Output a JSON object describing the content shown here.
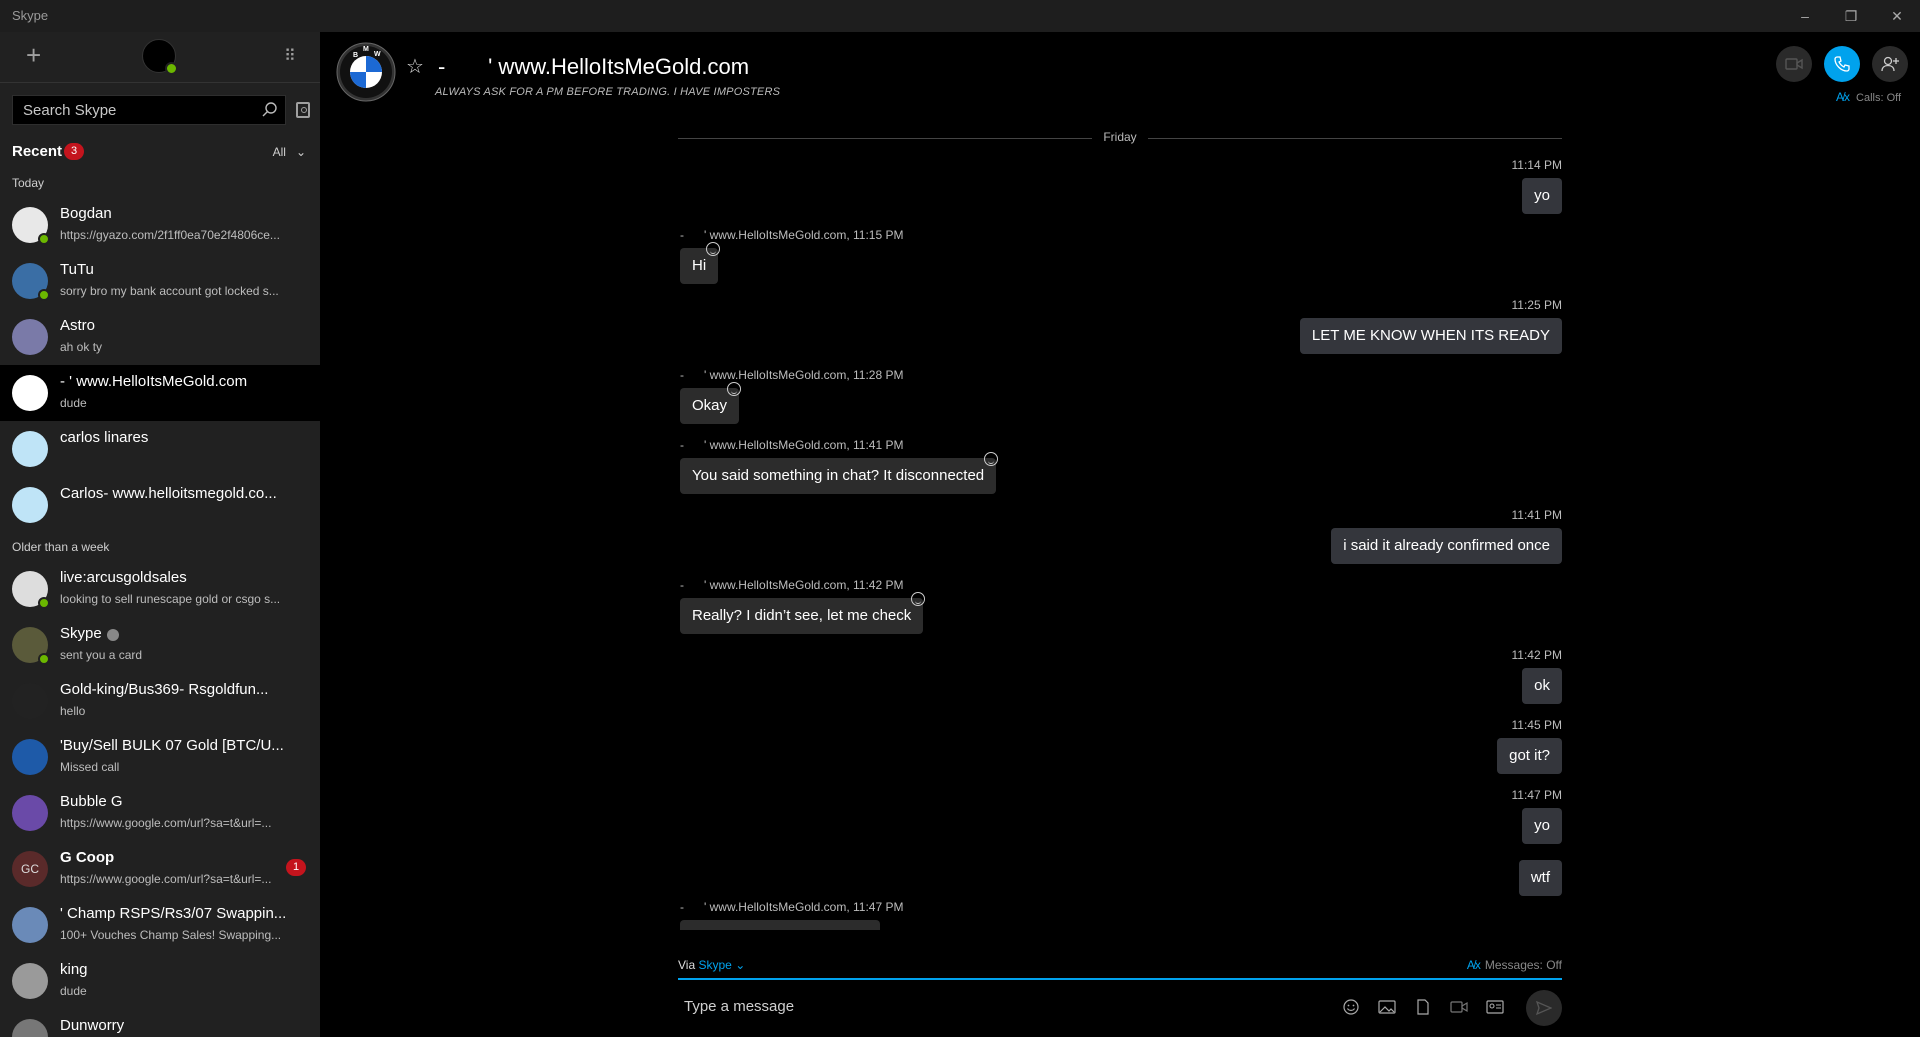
{
  "window": {
    "app_title": "Skype",
    "minimize": "–",
    "maximize": "❐",
    "close": "✕"
  },
  "sidebar": {
    "search_placeholder": "Search Skype",
    "recent_label": "Recent",
    "recent_badge": "3",
    "filter_label": "All",
    "sections": {
      "today": "Today",
      "older": "Older than a week"
    },
    "contacts": [
      {
        "name": "Bogdan",
        "preview": "https://gyazo.com/2f1ff0ea70e2f4806ce...",
        "online": true,
        "avatar_color": "#e8e8e8"
      },
      {
        "name": "TuTu",
        "preview": "sorry bro my bank account got locked s...",
        "online": true,
        "avatar_color": "#3a6ea5"
      },
      {
        "name": "Astro",
        "preview": "ah ok ty",
        "online": false,
        "avatar_color": "#7a7aa8"
      },
      {
        "name": "-       ' www.HelloItsMeGold.com",
        "preview": "dude",
        "online": false,
        "avatar_color": "#ffffff"
      },
      {
        "name": "carlos linares",
        "preview": "",
        "online": false,
        "avatar_color": "#bfe4f7"
      },
      {
        "name": "Carlos- www.helloitsmegold.co...",
        "preview": "",
        "online": false,
        "avatar_color": "#bfe4f7"
      },
      {
        "name": "live:arcusgoldsales",
        "preview": "looking to sell runescape gold or csgo s...",
        "online": true,
        "avatar_color": "#dddddd"
      },
      {
        "name": "Skype",
        "preview": "sent you a card",
        "online": true,
        "avatar_color": "#5a5a3a"
      },
      {
        "name": "Gold-king/Bus369- Rsgoldfun...",
        "preview": "hello",
        "online": false,
        "avatar_color": "#222222"
      },
      {
        "name": "'Buy/Sell BULK 07 Gold [BTC/U...",
        "preview": "Missed call",
        "online": false,
        "avatar_color": "#1e5aa8"
      },
      {
        "name": "Bubble G",
        "preview": "https://www.google.com/url?sa=t&url=...",
        "online": false,
        "avatar_color": "#6a4aa8"
      },
      {
        "name": "G Coop",
        "preview": "https://www.google.com/url?sa=t&url=...",
        "online": false,
        "avatar_color": "#5a2a2a",
        "initials": "GC",
        "unread": "1"
      },
      {
        "name": "' Champ RSPS/Rs3/07 Swappin...",
        "preview": "100+ Vouches Champ Sales! Swapping...",
        "online": false,
        "avatar_color": "#6a8ab8"
      },
      {
        "name": "king",
        "preview": "dude",
        "online": false,
        "avatar_color": "#9a9a9a"
      },
      {
        "name": "Dunworry",
        "preview": "",
        "online": false,
        "avatar_color": "#777777"
      }
    ]
  },
  "conversation": {
    "title": "-       ' www.HelloItsMeGold.com",
    "subtitle": "ALWAYS ASK FOR A PM BEFORE TRADING. I HAVE IMPOSTERS",
    "logo_letters": [
      "B",
      "M",
      "W"
    ],
    "calls_status": "Calls: Off",
    "translate_icon": "A̸x",
    "day_separator": "Friday",
    "sender_name": "-      ' www.HelloItsMeGold.com,",
    "messages": [
      {
        "dir": "out",
        "time": "11:14 PM",
        "text": "yo"
      },
      {
        "dir": "in",
        "time": "11:15 PM",
        "text": "Hi"
      },
      {
        "dir": "out",
        "time": "11:25 PM",
        "text": "LET ME KNOW WHEN ITS READY"
      },
      {
        "dir": "in",
        "time": "11:28 PM",
        "text": "Okay"
      },
      {
        "dir": "in",
        "time": "11:41 PM",
        "text": "You said something in chat? It disconnected"
      },
      {
        "dir": "out",
        "time": "11:41 PM",
        "text": "i said it already confirmed once"
      },
      {
        "dir": "in",
        "time": "11:42 PM",
        "text": "Really? I didn’t see, let me check"
      },
      {
        "dir": "out",
        "time": "11:42 PM",
        "text": "ok"
      },
      {
        "dir": "out",
        "time": "11:45 PM",
        "text": "got it?"
      },
      {
        "dir": "out",
        "time": "11:47 PM",
        "text": "yo"
      },
      {
        "dir": "out",
        "time": "",
        "text": "wtf"
      },
      {
        "dir": "in",
        "time": "11:47 PM",
        "text": ""
      }
    ]
  },
  "compose": {
    "via_label": "Via",
    "via_service": "Skype",
    "messages_status": "Messages: Off",
    "placeholder": "Type a message"
  }
}
